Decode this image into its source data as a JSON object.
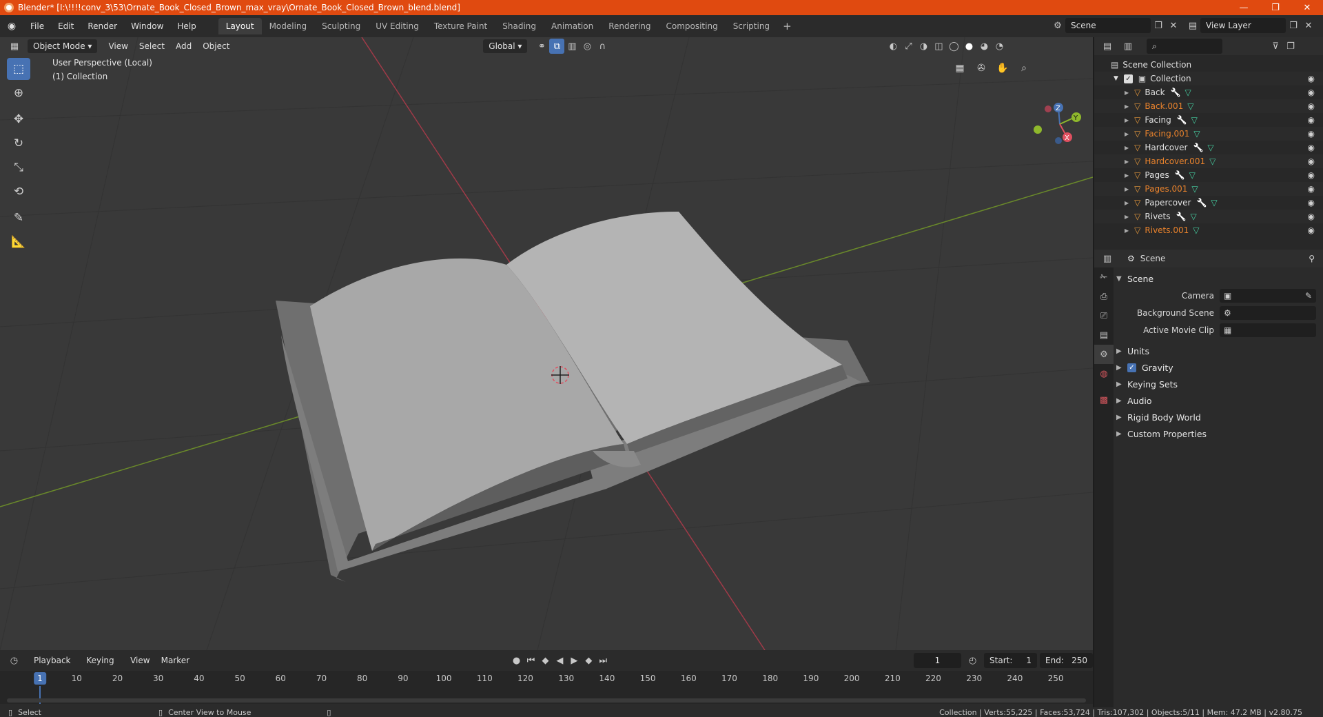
{
  "window": {
    "title": "Blender* [I:\\!!!!conv_3\\53\\Ornate_Book_Closed_Brown_max_vray\\Ornate_Book_Closed_Brown_blend.blend]",
    "minimize": "—",
    "maximize": "❐",
    "close": "✕"
  },
  "menu": [
    "File",
    "Edit",
    "Render",
    "Window",
    "Help"
  ],
  "workspaces": [
    "Layout",
    "Modeling",
    "Sculpting",
    "UV Editing",
    "Texture Paint",
    "Shading",
    "Animation",
    "Rendering",
    "Compositing",
    "Scripting"
  ],
  "workspace_add": "+",
  "scene_selector": {
    "value": "Scene"
  },
  "view_layer": {
    "value": "View Layer"
  },
  "viewport": {
    "mode": "Object Mode",
    "menus": [
      "View",
      "Select",
      "Add",
      "Object"
    ],
    "transform": "Global",
    "overlay_line1": "User Perspective (Local)",
    "overlay_line2": "(1) Collection",
    "gizmo": {
      "z": "Z",
      "y": "Y",
      "x": "X"
    }
  },
  "outliner": {
    "root": "Scene Collection",
    "collection": "Collection",
    "items": [
      {
        "name": "Back",
        "selected": false,
        "modifier": true
      },
      {
        "name": "Back.001",
        "selected": true,
        "modifier": false
      },
      {
        "name": "Facing",
        "selected": false,
        "modifier": true
      },
      {
        "name": "Facing.001",
        "selected": true,
        "modifier": false
      },
      {
        "name": "Hardcover",
        "selected": false,
        "modifier": true
      },
      {
        "name": "Hardcover.001",
        "selected": true,
        "modifier": false
      },
      {
        "name": "Pages",
        "selected": false,
        "modifier": true
      },
      {
        "name": "Pages.001",
        "selected": true,
        "modifier": false
      },
      {
        "name": "Papercover",
        "selected": false,
        "modifier": true
      },
      {
        "name": "Rivets",
        "selected": false,
        "modifier": true
      },
      {
        "name": "Rivets.001",
        "selected": true,
        "modifier": false
      }
    ]
  },
  "properties": {
    "header": "Scene",
    "panel_title": "Scene",
    "camera_label": "Camera",
    "background_label": "Background Scene",
    "movieclip_label": "Active Movie Clip",
    "sections": [
      "Units",
      "Gravity",
      "Keying Sets",
      "Audio",
      "Rigid Body World",
      "Custom Properties"
    ]
  },
  "timeline": {
    "menus": [
      "Playback",
      "Keying",
      "View",
      "Marker"
    ],
    "current_frame": "1",
    "start_label": "Start:",
    "start": "1",
    "end_label": "End:",
    "end": "250",
    "ticks": [
      "10",
      "20",
      "30",
      "40",
      "50",
      "60",
      "70",
      "80",
      "90",
      "100",
      "110",
      "120",
      "130",
      "140",
      "150",
      "160",
      "170",
      "180",
      "190",
      "200",
      "210",
      "220",
      "230",
      "240",
      "250"
    ]
  },
  "status": {
    "left": "Select",
    "middle": "Center View to Mouse",
    "right": "Collection | Verts:55,225 | Faces:53,724 | Tris:107,302 | Objects:5/11 | Mem: 47.2 MB | v2.80.75"
  },
  "colors": {
    "accent": "#4772b3",
    "titlebar": "#e04a10",
    "selected_text": "#e8822c",
    "axis_x": "#e05060",
    "axis_y": "#8fb82c"
  }
}
